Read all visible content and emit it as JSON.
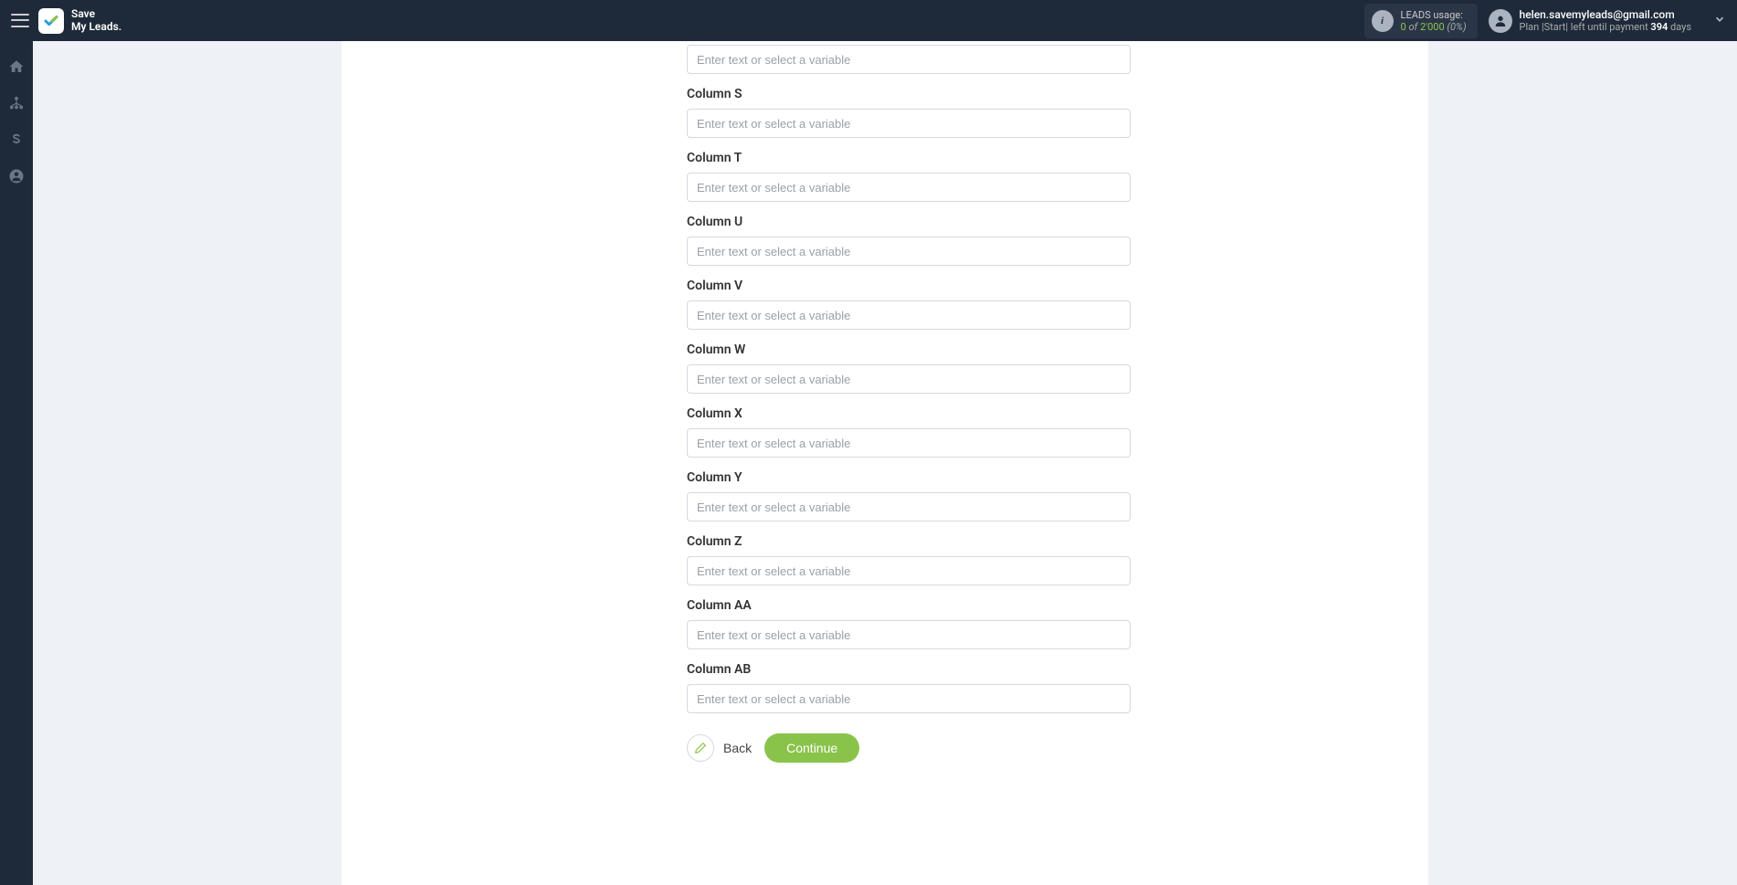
{
  "brand": {
    "line1": "Save",
    "line2": "My Leads."
  },
  "usage": {
    "label": "LEADS usage:",
    "used": "0",
    "of_word": "of",
    "total": "2'000",
    "pct": "(0%)"
  },
  "user": {
    "email": "helen.savemyleads@gmail.com",
    "plan_prefix": "Plan |",
    "plan_name": "Start",
    "plan_mid": "| left until payment ",
    "days": "394",
    "days_suffix": " days"
  },
  "form": {
    "placeholder": "Enter text or select a variable",
    "fields": [
      {
        "label": "",
        "key": "r"
      },
      {
        "label": "Column S",
        "key": "s"
      },
      {
        "label": "Column T",
        "key": "t"
      },
      {
        "label": "Column U",
        "key": "u"
      },
      {
        "label": "Column V",
        "key": "v"
      },
      {
        "label": "Column W",
        "key": "w"
      },
      {
        "label": "Column X",
        "key": "x"
      },
      {
        "label": "Column Y",
        "key": "y"
      },
      {
        "label": "Column Z",
        "key": "z"
      },
      {
        "label": "Column AA",
        "key": "aa"
      },
      {
        "label": "Column AB",
        "key": "ab"
      }
    ]
  },
  "actions": {
    "back": "Back",
    "continue": "Continue"
  }
}
